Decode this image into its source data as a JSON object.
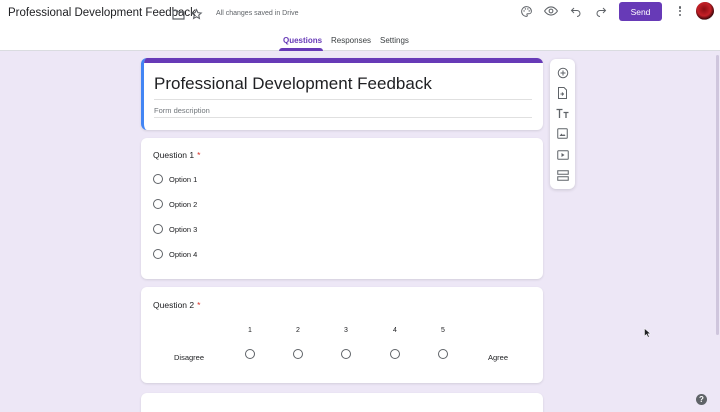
{
  "app": {
    "title": "Professional Development Feedback",
    "save_status": "All changes saved in Drive",
    "send_label": "Send"
  },
  "tabs": [
    {
      "label": "Questions",
      "active": true
    },
    {
      "label": "Responses",
      "active": false
    },
    {
      "label": "Settings",
      "active": false
    }
  ],
  "form": {
    "title": "Professional Development Feedback",
    "description_placeholder": "Form description"
  },
  "questions": [
    {
      "title": "Question 1",
      "required_mark": "*",
      "options": [
        "Option 1",
        "Option 2",
        "Option 3",
        "Option 4"
      ]
    },
    {
      "title": "Question 2",
      "required_mark": "*",
      "scale": [
        "1",
        "2",
        "3",
        "4",
        "5"
      ],
      "low_label": "Disagree",
      "high_label": "Agree"
    }
  ],
  "toolbar": [
    "add-question-icon",
    "import-questions-icon",
    "add-title-icon",
    "add-image-icon",
    "add-video-icon",
    "add-section-icon"
  ],
  "colors": {
    "accent": "#673ab7",
    "background": "#ede7f6",
    "required": "#d93025",
    "title_border": "#4285f4"
  }
}
